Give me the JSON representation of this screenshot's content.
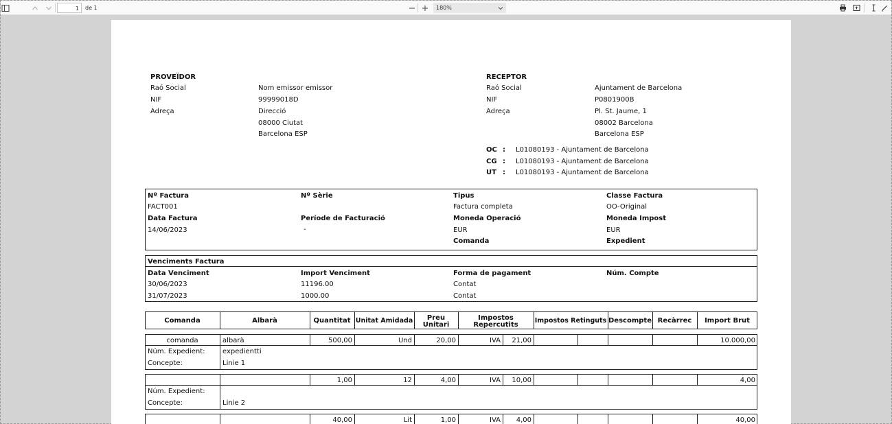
{
  "toolbar": {
    "sidebar_icon": "sidebar-toggle-icon",
    "page_current": "1",
    "page_total": "de 1",
    "zoom_out": "—",
    "zoom_in": "+",
    "zoom_level": "180%"
  },
  "supplier": {
    "title": "PROVEÏDOR",
    "labels": [
      "Raó Social",
      "NIF",
      "Adreça"
    ],
    "values": [
      "Nom emissor  emissor",
      "99999018D",
      "Direcció",
      "08000 Ciutat",
      "Barcelona ESP"
    ]
  },
  "receiver": {
    "title": "RECEPTOR",
    "labels": [
      "Raó Social",
      "NIF",
      "Adreça"
    ],
    "values": [
      "Ajuntament de Barcelona",
      "P0801900B",
      "Pl. St. Jaume, 1",
      "08002 Barcelona",
      "Barcelona ESP"
    ]
  },
  "codes": [
    {
      "label": "OC",
      "sep": ":",
      "value": "L01080193 - Ajuntament de Barcelona"
    },
    {
      "label": "CG",
      "sep": ":",
      "value": "L01080193 - Ajuntament de Barcelona"
    },
    {
      "label": "UT",
      "sep": ":",
      "value": "L01080193 - Ajuntament de Barcelona"
    }
  ],
  "invoice": {
    "num_label": "Nº Factura",
    "num": "FACT001",
    "serie_label": "Nº Sèrie",
    "tipus_label": "Tipus",
    "tipus": "Factura completa",
    "classe_label": "Classe Factura",
    "classe": "OO-Original",
    "date_label": "Data Factura",
    "date": "14/06/2023",
    "periode_label": "Període de Facturació",
    "periode": "-",
    "moneda_op_label": "Moneda Operació",
    "moneda_op": "EUR",
    "moneda_imp_label": "Moneda Impost",
    "moneda_imp": "EUR",
    "comanda_label": "Comanda",
    "expedient_label": "Expedient"
  },
  "due": {
    "title": "Venciments Factura",
    "headers": [
      "Data Venciment",
      "Import Venciment",
      "Forma de pagament",
      "Núm. Compte"
    ],
    "rows": [
      [
        "30/06/2023",
        "11196.00",
        "Contat"
      ],
      [
        "31/07/2023",
        "1000.00",
        "Contat"
      ]
    ]
  },
  "lines": {
    "headers": {
      "comanda": "Comanda",
      "albara": "Albarà",
      "quantitat": "Quantitat",
      "unitat": "Unitat Amidada",
      "preu_1": "Preu",
      "preu_2": "Unitari",
      "imp_rep_1": "Impostos",
      "imp_rep_2": "Repercutits",
      "imp_ret": "Impostos Retinguts",
      "descompte": "Descompte",
      "recarrec": "Recàrrec",
      "import_brut": "Import Brut"
    },
    "expedient_label": "Núm. Expedient:",
    "concepte_label": "Concepte:",
    "rows": [
      {
        "comanda": "comanda",
        "albara": "albarà",
        "quantitat": "500,00",
        "unitat": "Und",
        "preu": "20,00",
        "tax": "IVA",
        "rate": "21,00",
        "brut": "10.000,00",
        "expedient": "expedientti",
        "concepte": "Linie 1"
      },
      {
        "comanda": "",
        "albara": "",
        "quantitat": "1,00",
        "unitat": "12",
        "preu": "4,00",
        "tax": "IVA",
        "rate": "10,00",
        "brut": "4,00",
        "expedient": "",
        "concepte": "Linie 2"
      },
      {
        "comanda": "",
        "albara": "",
        "quantitat": "40,00",
        "unitat": "Lit",
        "preu": "1,00",
        "tax": "IVA",
        "rate": "4,00",
        "brut": "40,00"
      }
    ]
  }
}
